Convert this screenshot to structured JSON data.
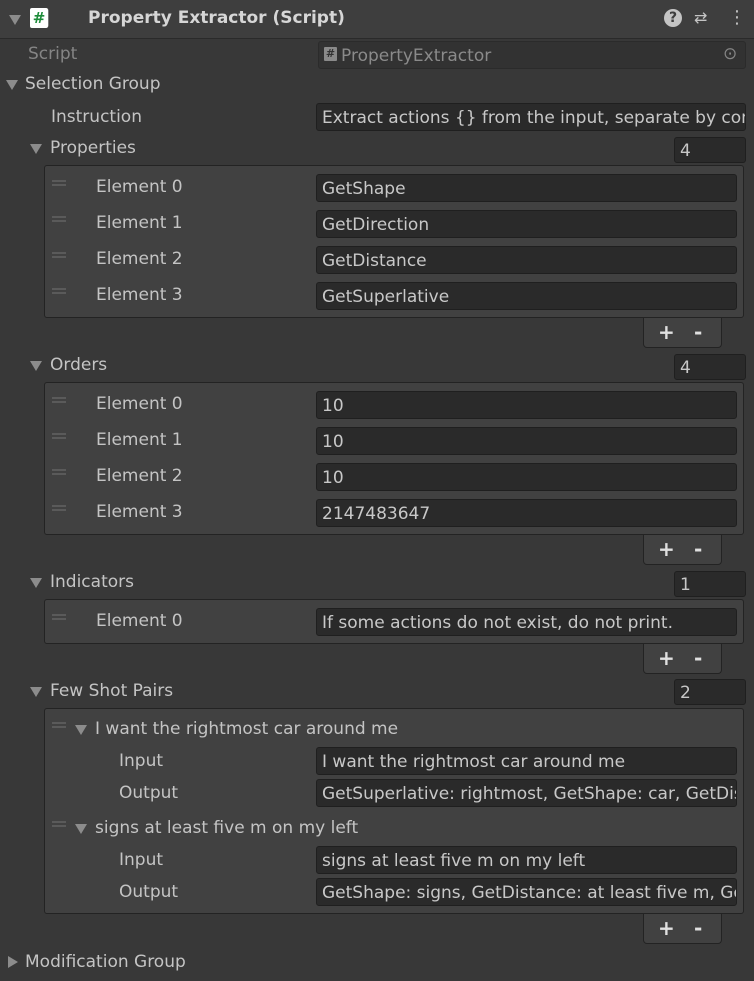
{
  "header": {
    "title": "Property Extractor (Script)"
  },
  "script": {
    "label": "Script",
    "value": "PropertyExtractor"
  },
  "selection_group": {
    "label": "Selection Group",
    "instruction_label": "Instruction",
    "instruction_value": "Extract actions {} from the input, separate by com",
    "properties": {
      "label": "Properties",
      "count": "4",
      "items": [
        {
          "label": "Element 0",
          "value": "GetShape"
        },
        {
          "label": "Element 1",
          "value": "GetDirection"
        },
        {
          "label": "Element 2",
          "value": "GetDistance"
        },
        {
          "label": "Element 3",
          "value": "GetSuperlative"
        }
      ]
    },
    "orders": {
      "label": "Orders",
      "count": "4",
      "items": [
        {
          "label": "Element 0",
          "value": "10"
        },
        {
          "label": "Element 1",
          "value": "10"
        },
        {
          "label": "Element 2",
          "value": "10"
        },
        {
          "label": "Element 3",
          "value": "2147483647"
        }
      ]
    },
    "indicators": {
      "label": "Indicators",
      "count": "1",
      "items": [
        {
          "label": "Element 0",
          "value": "If some actions do not exist, do not print."
        }
      ]
    },
    "few_shot_pairs": {
      "label": "Few Shot Pairs",
      "count": "2",
      "items": [
        {
          "title": "I want the rightmost car around me",
          "input_label": "Input",
          "input": "I want the rightmost car around me",
          "output_label": "Output",
          "output": "GetSuperlative: rightmost, GetShape: car, GetDis"
        },
        {
          "title": "signs at least five m on my left",
          "input_label": "Input",
          "input": "signs at least five m on my left",
          "output_label": "Output",
          "output": "GetShape: signs, GetDistance: at least five m, Ge"
        }
      ]
    }
  },
  "modification_group": {
    "label": "Modification Group"
  },
  "list_controls": {
    "add": "+",
    "remove": "-"
  },
  "icons": {
    "script": "#",
    "help": "?",
    "settings": "⇄",
    "menu": "⋮",
    "object_picker": "⊙"
  }
}
